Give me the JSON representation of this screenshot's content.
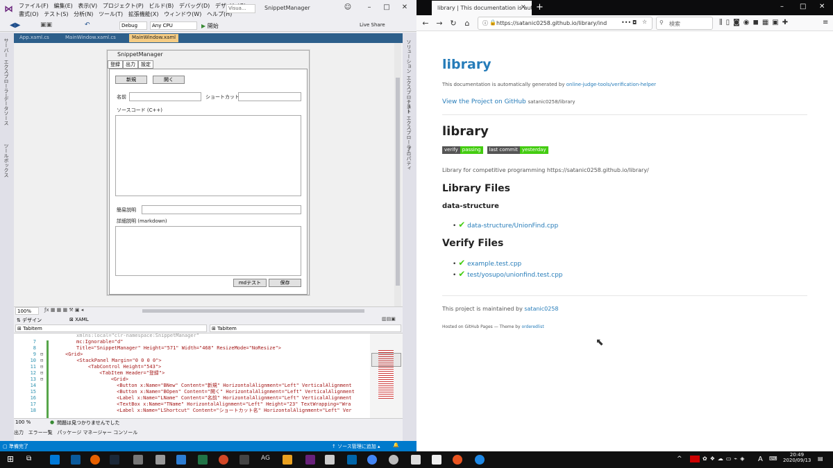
{
  "vs": {
    "menu_row1": [
      "ファイル(F)",
      "編集(E)",
      "表示(V)",
      "プロジェクト(P)",
      "ビルド(B)",
      "デバッグ(D)",
      "デザイン(G)"
    ],
    "menu_row2": [
      "書式(O)",
      "テスト(S)",
      "分析(N)",
      "ツール(T)",
      "拡張機能(X)",
      "ウィンドウ(W)",
      "ヘルプ(H)"
    ],
    "search_text": "Visua...",
    "project_name": "SnippetManager",
    "config": "Debug",
    "platform": "Any CPU",
    "start_label": "開始",
    "live_share": "Live Share",
    "left_tool_label1": "サーバー エクスプローラー",
    "left_tool_label2": "データソース",
    "left_tool_label3": "ツールボックス",
    "right_tool_label1": "ソリューション エクスプローラー",
    "right_tool_label2": "テスト エクスプローラー",
    "right_tool_label3": "プロパティ",
    "doc_tabs": [
      "App.xaml.cs",
      "MainWindow.xaml.cs",
      "MainWindow.xaml"
    ],
    "form": {
      "title": "SnippetManager",
      "tabs": [
        "登録",
        "出力",
        "設定"
      ],
      "btn_new": "新規",
      "btn_open": "開く",
      "lbl_name": "名前",
      "lbl_shortcut": "ショートカット名",
      "lbl_source": "ソースコード (C++)",
      "lbl_short_desc": "簡易説明",
      "lbl_detail_desc": "詳細説明 (markdown)",
      "btn_mdtest": "mdテスト",
      "btn_save": "保存"
    },
    "zoom": "100%",
    "split_design": "デザイン",
    "split_xaml": "XAML",
    "tabitem_left": "TabItem",
    "tabitem_right": "TabItem",
    "code_lines": [
      {
        "n": "",
        "t": "xmlns:local=\"clr-namespace:SnippetManager\""
      },
      {
        "n": "7",
        "t": "mc:Ignorable=\"d\""
      },
      {
        "n": "8",
        "t": "Title=\"SnippetManager\" Height=\"571\" Width=\"468\" ResizeMode=\"NoResize\">"
      },
      {
        "n": "9",
        "t": "<Grid>"
      },
      {
        "n": "10",
        "t": "  <StackPanel Margin=\"0 0 0 0\">"
      },
      {
        "n": "11",
        "t": "    <TabControl Height=\"543\">"
      },
      {
        "n": "12",
        "t": "      <TabItem Header=\"登録\">"
      },
      {
        "n": "13",
        "t": "        <Grid>"
      },
      {
        "n": "14",
        "t": "          <Button x:Name=\"BNew\" Content=\"新規\" HorizontalAlignment=\"Left\" VerticalAlignment"
      },
      {
        "n": "15",
        "t": "          <Button x:Name=\"BOpen\" Content=\"開く\" HorizontalAlignment=\"Left\" VerticalAlignment"
      },
      {
        "n": "16",
        "t": "          <Label x:Name=\"LName\" Content=\"名前\" HorizontalAlignment=\"Left\" VerticalAlignment"
      },
      {
        "n": "17",
        "t": "          <TextBox x:Name=\"TName\" HorizontalAlignment=\"Left\" Height=\"23\" TextWrapping=\"Wra"
      },
      {
        "n": "18",
        "t": "          <Label x:Name=\"LShortcut\" Content=\"ショートカット名\" HorizontalAlignment=\"Left\" Ver"
      }
    ],
    "code_zoom": "100 %",
    "code_status": "問題は見つかりませんでした",
    "output_tabs": [
      "出力",
      "エラー一覧",
      "パッケージ マネージャー コンソール"
    ],
    "status_ready": "準備完了",
    "status_source": "ソース管理に追加"
  },
  "ff": {
    "tab_title": "library | This documentation is aut",
    "url": "https://satanic0258.github.io/library/ind",
    "search_placeholder": "検索",
    "page": {
      "site_title": "library",
      "auto_gen_prefix": "This documentation is automatically generated by",
      "auto_gen_link": "online-judge-tools/verification-helper",
      "view_project": "View the Project on GitHub",
      "repo": "satanic0258/library",
      "h1": "library",
      "badge_verify_l": "verify",
      "badge_verify_r": "passing",
      "badge_commit_l": "last commit",
      "badge_commit_r": "yesterday",
      "description": "Library for competitive programming https://satanic0258.github.io/library/",
      "library_files": "Library Files",
      "data_structure": "data-structure",
      "lib_items": [
        "data-structure/UnionFind.cpp"
      ],
      "verify_files": "Verify Files",
      "verify_items": [
        "example.test.cpp",
        "test/yosupo/unionfind.test.cpp"
      ],
      "maintained_prefix": "This project is maintained by",
      "maintainer": "satanic0258",
      "hosted": "Hosted on GitHub Pages — Theme by",
      "theme": "orderedlist"
    }
  },
  "taskbar": {
    "ime": "A",
    "time": "20:49",
    "date": "2020/09/13"
  },
  "colors": {
    "vs_accent": "#007acc",
    "link": "#267cb9",
    "badge_green": "#44cc11"
  }
}
